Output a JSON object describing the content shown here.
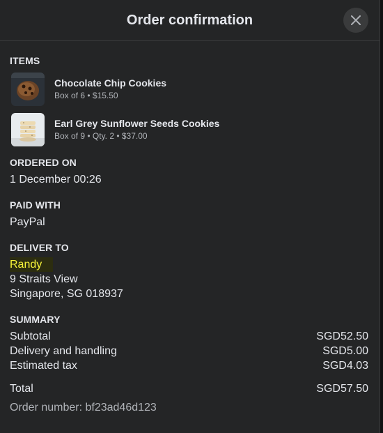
{
  "dialog": {
    "title": "Order confirmation"
  },
  "items_section": {
    "label": "ITEMS",
    "items": [
      {
        "name": "Chocolate Chip Cookies",
        "details": "Box of 6 • $15.50",
        "thumbnail_icon": "chocolate-chip-cookie-image"
      },
      {
        "name": "Earl Grey Sunflower Seeds Cookies",
        "details": "Box of 9 • Qty. 2 • $37.00",
        "thumbnail_icon": "stacked-cookies-image"
      }
    ]
  },
  "ordered_on": {
    "label": "ORDERED ON",
    "value": "1 December 00:26"
  },
  "paid_with": {
    "label": "PAID WITH",
    "value": "PayPal"
  },
  "deliver_to": {
    "label": "DELIVER TO",
    "name": "Randy",
    "address_line1": "9 Straits View",
    "address_line2": "Singapore, SG 018937"
  },
  "summary": {
    "label": "SUMMARY",
    "rows": [
      {
        "label": "Subtotal",
        "value": "SGD52.50"
      },
      {
        "label": "Delivery and handling",
        "value": "SGD5.00"
      },
      {
        "label": "Estimated tax",
        "value": "SGD4.03"
      }
    ],
    "total_label": "Total",
    "total_value": "SGD57.50"
  },
  "order_number": "Order number: bf23ad46d123",
  "colors": {
    "background": "#242526",
    "highlight_text": "#f7f43a",
    "secondary_text": "#b0b3b8"
  }
}
